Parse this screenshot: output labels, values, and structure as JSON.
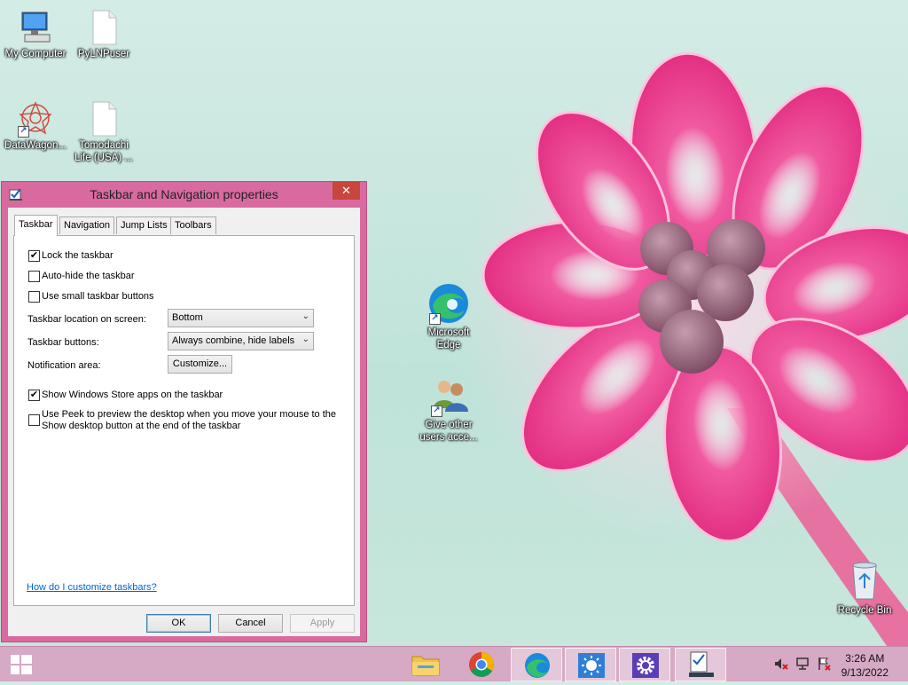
{
  "desktop": {
    "icons": {
      "my_computer": "My Computer",
      "pylnp": "PyLNPuser",
      "datawagon": "DataWagon...",
      "tomodachi_l1": "Tomodachi",
      "tomodachi_l2": "Life (USA) ...",
      "edge_l1": "Microsoft",
      "edge_l2": "Edge",
      "give_l1": "Give other",
      "give_l2": "users acce...",
      "recycle": "Recycle Bin"
    }
  },
  "dialog": {
    "title": "Taskbar and Navigation properties",
    "close_glyph": "✕",
    "tabs": [
      "Taskbar",
      "Navigation",
      "Jump Lists",
      "Toolbars"
    ],
    "active_tab": "Taskbar",
    "options": {
      "lock": {
        "label": "Lock the taskbar",
        "checked": true,
        "mark": "✔"
      },
      "autohide": {
        "label": "Auto-hide the taskbar",
        "checked": false,
        "mark": ""
      },
      "small": {
        "label": "Use small taskbar buttons",
        "checked": false,
        "mark": ""
      },
      "store": {
        "label": "Show Windows Store apps on the taskbar",
        "checked": true,
        "mark": "✔"
      },
      "peek_l1": "Use Peek to preview the desktop when you move your mouse to the",
      "peek_l2": "Show desktop button at the end of the taskbar",
      "peek_mark": ""
    },
    "fields": {
      "location_label": "Taskbar location on screen:",
      "location_value": "Bottom",
      "buttons_label": "Taskbar buttons:",
      "buttons_value": "Always combine, hide labels",
      "notification_label": "Notification area:",
      "customize_button": "Customize..."
    },
    "help_link": "How do I customize taskbars?",
    "ok_button": "OK",
    "cancel_button": "Cancel",
    "apply_button": "Apply"
  },
  "taskbar": {
    "clock_time": "3:26 AM",
    "clock_date": "9/13/2022",
    "apps": [
      "file-explorer",
      "chrome",
      "edge",
      "brightness",
      "settings",
      "taskbar-properties"
    ]
  },
  "colors": {
    "dialog_frame": "#d96aa0",
    "taskbar": "#d6a9c4",
    "close_button": "#c7463e",
    "link": "#0066cc"
  }
}
